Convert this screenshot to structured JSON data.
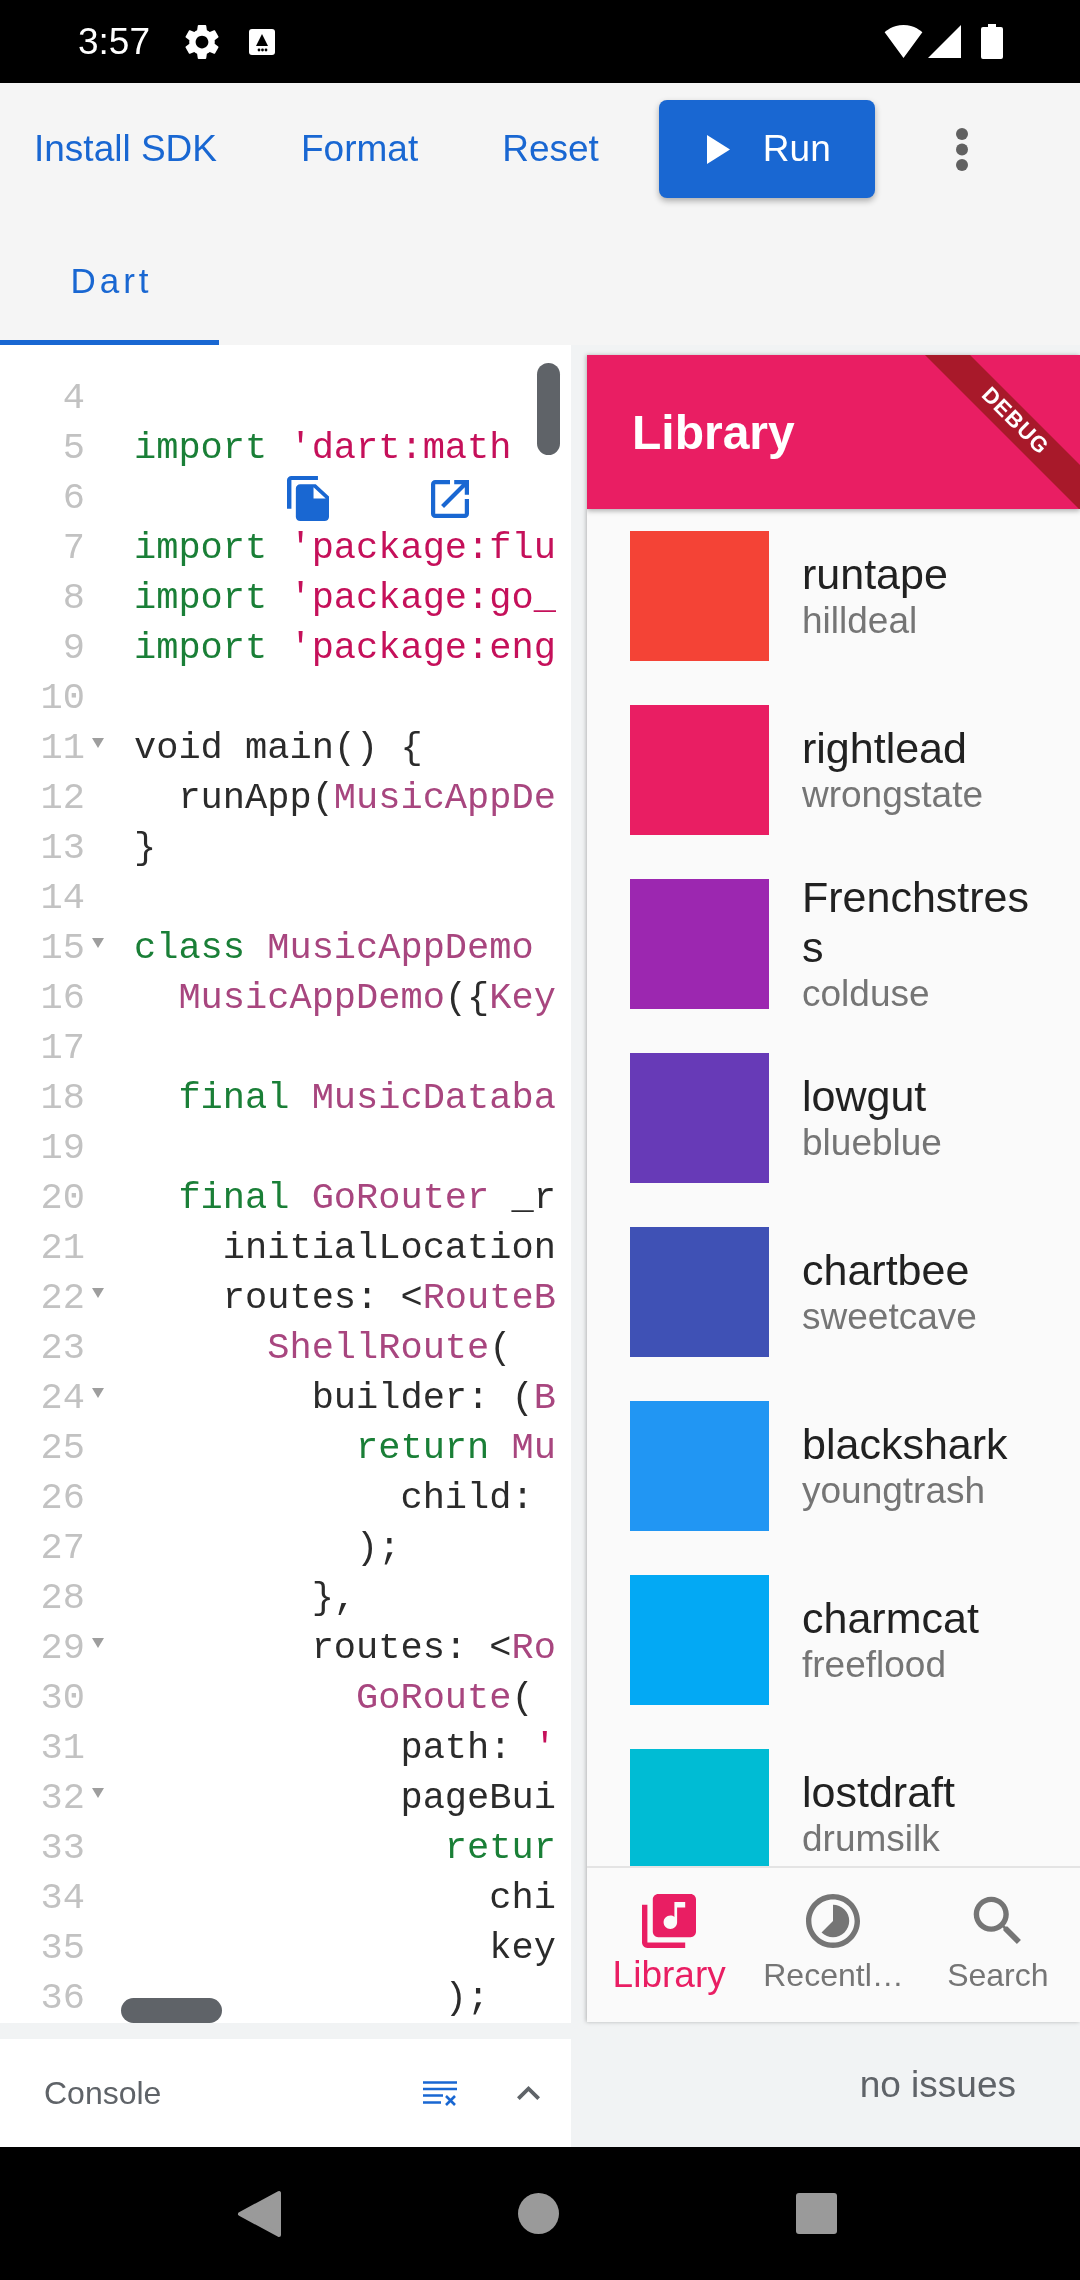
{
  "status_bar": {
    "time": "3:57"
  },
  "toolbar": {
    "buttons": [
      {
        "kind": "text",
        "label": "Install SDK"
      },
      {
        "kind": "text",
        "label": "Format"
      },
      {
        "kind": "text",
        "label": "Reset"
      },
      {
        "kind": "primary",
        "label": "Run"
      },
      {
        "kind": "overflow"
      }
    ]
  },
  "tabs": [
    {
      "label": "Dart",
      "selected": true
    }
  ],
  "editor": {
    "lines": [
      {
        "number": "4",
        "foldable": false
      },
      {
        "number": "5",
        "foldable": false,
        "tokens": [
          {
            "kind": "keyword",
            "text": "import"
          },
          {
            "kind": "string",
            "text": " 'dart:math"
          }
        ]
      },
      {
        "number": "6",
        "foldable": false
      },
      {
        "number": "7",
        "foldable": false,
        "tokens": [
          {
            "kind": "keyword",
            "text": "import"
          },
          {
            "kind": "string",
            "text": " 'package:flu"
          }
        ]
      },
      {
        "number": "8",
        "foldable": false,
        "tokens": [
          {
            "kind": "keyword",
            "text": "import"
          },
          {
            "kind": "string",
            "text": " 'package:go_"
          }
        ]
      },
      {
        "number": "9",
        "foldable": false,
        "tokens": [
          {
            "kind": "keyword",
            "text": "import"
          },
          {
            "kind": "string",
            "text": " 'package:eng"
          }
        ]
      },
      {
        "number": "10",
        "foldable": false
      },
      {
        "number": "11",
        "foldable": true,
        "tokens": [
          {
            "kind": "plain",
            "text": "void main() {"
          }
        ]
      },
      {
        "number": "12",
        "foldable": false,
        "tokens": [
          {
            "kind": "plain",
            "text": "  runApp("
          },
          {
            "kind": "type",
            "text": "MusicAppDe"
          }
        ]
      },
      {
        "number": "13",
        "foldable": false,
        "tokens": [
          {
            "kind": "plain",
            "text": "}"
          }
        ]
      },
      {
        "number": "14",
        "foldable": false
      },
      {
        "number": "15",
        "foldable": true,
        "tokens": [
          {
            "kind": "keyword",
            "text": "class"
          },
          {
            "kind": "type",
            "text": " MusicAppDemo"
          }
        ]
      },
      {
        "number": "16",
        "foldable": false,
        "tokens": [
          {
            "kind": "type",
            "text": "  MusicAppDemo"
          },
          {
            "kind": "plain",
            "text": "({"
          },
          {
            "kind": "type",
            "text": "Key"
          }
        ]
      },
      {
        "number": "17",
        "foldable": false
      },
      {
        "number": "18",
        "foldable": false,
        "tokens": [
          {
            "kind": "keyword",
            "text": "  final"
          },
          {
            "kind": "type",
            "text": " MusicDataba"
          }
        ]
      },
      {
        "number": "19",
        "foldable": false
      },
      {
        "number": "20",
        "foldable": false,
        "tokens": [
          {
            "kind": "keyword",
            "text": "  final"
          },
          {
            "kind": "type",
            "text": " GoRouter"
          },
          {
            "kind": "plain",
            "text": " _r"
          }
        ]
      },
      {
        "number": "21",
        "foldable": false,
        "tokens": [
          {
            "kind": "plain",
            "text": "    initialLocation"
          }
        ]
      },
      {
        "number": "22",
        "foldable": true,
        "tokens": [
          {
            "kind": "plain",
            "text": "    routes: <"
          },
          {
            "kind": "type",
            "text": "RouteB"
          }
        ]
      },
      {
        "number": "23",
        "foldable": false,
        "tokens": [
          {
            "kind": "type",
            "text": "      ShellRoute"
          },
          {
            "kind": "plain",
            "text": "("
          }
        ]
      },
      {
        "number": "24",
        "foldable": true,
        "tokens": [
          {
            "kind": "plain",
            "text": "        builder: ("
          },
          {
            "kind": "type",
            "text": "B"
          }
        ]
      },
      {
        "number": "25",
        "foldable": false,
        "tokens": [
          {
            "kind": "keyword",
            "text": "          return"
          },
          {
            "kind": "type",
            "text": " Mu"
          }
        ]
      },
      {
        "number": "26",
        "foldable": false,
        "tokens": [
          {
            "kind": "plain",
            "text": "            child:"
          }
        ]
      },
      {
        "number": "27",
        "foldable": false,
        "tokens": [
          {
            "kind": "plain",
            "text": "          );"
          }
        ]
      },
      {
        "number": "28",
        "foldable": false,
        "tokens": [
          {
            "kind": "plain",
            "text": "        },"
          }
        ]
      },
      {
        "number": "29",
        "foldable": true,
        "tokens": [
          {
            "kind": "plain",
            "text": "        routes: <"
          },
          {
            "kind": "type",
            "text": "Ro"
          }
        ]
      },
      {
        "number": "30",
        "foldable": false,
        "tokens": [
          {
            "kind": "type",
            "text": "          GoRoute"
          },
          {
            "kind": "plain",
            "text": "("
          }
        ]
      },
      {
        "number": "31",
        "foldable": false,
        "tokens": [
          {
            "kind": "plain",
            "text": "            path: "
          },
          {
            "kind": "string",
            "text": "'"
          }
        ]
      },
      {
        "number": "32",
        "foldable": true,
        "tokens": [
          {
            "kind": "plain",
            "text": "            pageBui"
          }
        ]
      },
      {
        "number": "33",
        "foldable": false,
        "tokens": [
          {
            "kind": "keyword",
            "text": "              retur"
          }
        ]
      },
      {
        "number": "34",
        "foldable": false,
        "tokens": [
          {
            "kind": "plain",
            "text": "                chi"
          }
        ]
      },
      {
        "number": "35",
        "foldable": false,
        "tokens": [
          {
            "kind": "plain",
            "text": "                key"
          }
        ]
      },
      {
        "number": "36",
        "foldable": false,
        "tokens": [
          {
            "kind": "plain",
            "text": "              );"
          }
        ]
      }
    ]
  },
  "console": {
    "title": "Console"
  },
  "preview": {
    "app_bar": {
      "title": "Library",
      "debug_banner": "DEBUG"
    },
    "items": [
      {
        "title": "runtape",
        "subtitle": "hilldeal",
        "color": "#f44336"
      },
      {
        "title": "rightlead",
        "subtitle": "wrongstate",
        "color": "#e91e63"
      },
      {
        "title": "Frenchstress",
        "subtitle": "colduse",
        "color": "#9c27b0"
      },
      {
        "title": "lowgut",
        "subtitle": "blueblue",
        "color": "#673ab7"
      },
      {
        "title": "chartbee",
        "subtitle": "sweetcave",
        "color": "#3f51b5"
      },
      {
        "title": "blackshark",
        "subtitle": "youngtrash",
        "color": "#2196f3"
      },
      {
        "title": "charmcat",
        "subtitle": "freeflood",
        "color": "#03a9f4"
      },
      {
        "title": "lostdraft",
        "subtitle": "drumsilk",
        "color": "#00bcd4"
      }
    ],
    "bottom_nav": [
      {
        "kind": "library",
        "label": "Library",
        "selected": true
      },
      {
        "kind": "recent",
        "label": "Recentl…",
        "selected": false
      },
      {
        "kind": "search",
        "label": "Search",
        "selected": false
      }
    ]
  },
  "issues": {
    "status": "no issues"
  }
}
